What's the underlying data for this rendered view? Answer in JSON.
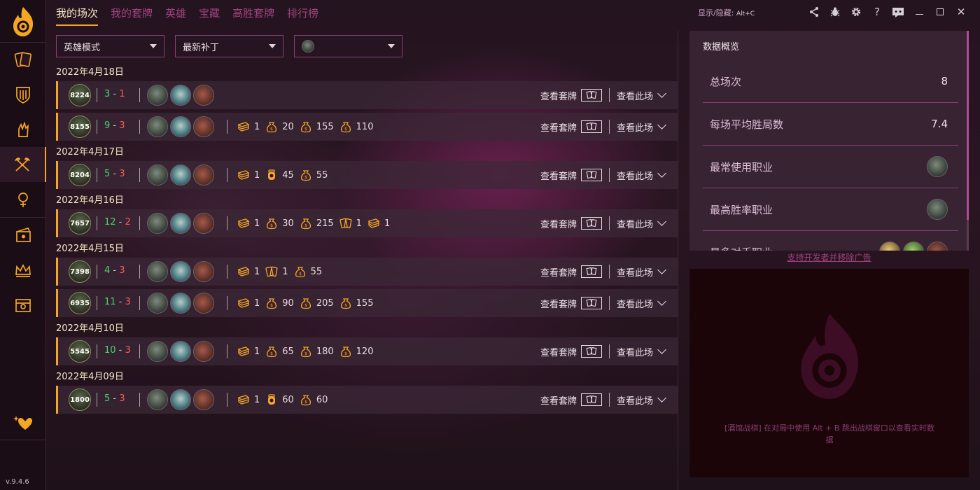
{
  "tabs": [
    {
      "label": "我的场次",
      "active": true
    },
    {
      "label": "我的套牌",
      "active": false
    },
    {
      "label": "英雄",
      "active": false
    },
    {
      "label": "宝藏",
      "active": false
    },
    {
      "label": "高胜套牌",
      "active": false
    },
    {
      "label": "排行榜",
      "active": false
    }
  ],
  "window": {
    "hotkey_label": "显示/隐藏:",
    "hotkey_keys": "Alt+C",
    "icons": [
      "share-icon",
      "bug-icon",
      "settings-icon",
      "help-icon",
      "discord-icon",
      "minimize-icon",
      "maximize-icon",
      "close-icon"
    ]
  },
  "sidebar": {
    "version": "v.9.4.6",
    "items": [
      "cards-icon",
      "deck-shield-icon",
      "arena-hand-icon",
      "duels-crossed-axes-icon",
      "mercenary-icon",
      "tavern-brawl-icon",
      "battlegrounds-crown-icon",
      "treasure-chest-icon"
    ],
    "active_index": 3,
    "bottom_icon": "heart-sparkle-icon"
  },
  "filters": {
    "mode": "英雄模式",
    "patch": "最新补丁",
    "hero": ""
  },
  "labels": {
    "view_deck": "查看套牌",
    "view_match": "查看此场"
  },
  "groups": [
    {
      "date": "2022年4月18日",
      "runs": [
        {
          "rating": "8224",
          "wins": "3",
          "losses": "1",
          "stats": []
        },
        {
          "rating": "8155",
          "wins": "9",
          "losses": "3",
          "stats": [
            {
              "icon": "card-pack-icon",
              "value": "1"
            },
            {
              "icon": "gold-bag-icon",
              "value": "20"
            },
            {
              "icon": "gold-bag-icon",
              "value": "155"
            },
            {
              "icon": "gold-bag-icon",
              "value": "110"
            }
          ]
        }
      ]
    },
    {
      "date": "2022年4月17日",
      "runs": [
        {
          "rating": "8204",
          "wins": "5",
          "losses": "3",
          "stats": [
            {
              "icon": "card-pack-icon",
              "value": "1"
            },
            {
              "icon": "gold-jar-icon",
              "value": "45"
            },
            {
              "icon": "gold-bag-icon",
              "value": "55"
            }
          ]
        }
      ]
    },
    {
      "date": "2022年4月16日",
      "runs": [
        {
          "rating": "7657",
          "wins": "12",
          "losses": "2",
          "stats": [
            {
              "icon": "card-pack-icon",
              "value": "1"
            },
            {
              "icon": "gold-bag-icon",
              "value": "30"
            },
            {
              "icon": "gold-bag-icon",
              "value": "215"
            },
            {
              "icon": "cards-icon",
              "value": "1"
            },
            {
              "icon": "card-pack-icon",
              "value": "1"
            }
          ]
        }
      ]
    },
    {
      "date": "2022年4月15日",
      "runs": [
        {
          "rating": "7398",
          "wins": "4",
          "losses": "3",
          "stats": [
            {
              "icon": "card-pack-icon",
              "value": "1"
            },
            {
              "icon": "cards-icon",
              "value": "1"
            },
            {
              "icon": "gold-bag-icon",
              "value": "55"
            }
          ]
        },
        {
          "rating": "6935",
          "wins": "11",
          "losses": "3",
          "stats": [
            {
              "icon": "card-pack-icon",
              "value": "1"
            },
            {
              "icon": "gold-bag-icon",
              "value": "90"
            },
            {
              "icon": "gold-bag-icon",
              "value": "205"
            },
            {
              "icon": "gold-bag-icon",
              "value": "155"
            }
          ]
        }
      ]
    },
    {
      "date": "2022年4月10日",
      "runs": [
        {
          "rating": "5545",
          "wins": "10",
          "losses": "3",
          "stats": [
            {
              "icon": "card-pack-icon",
              "value": "1"
            },
            {
              "icon": "gold-bag-icon",
              "value": "65"
            },
            {
              "icon": "gold-bag-icon",
              "value": "180"
            },
            {
              "icon": "gold-bag-icon",
              "value": "120"
            }
          ]
        }
      ]
    },
    {
      "date": "2022年4月09日",
      "runs": [
        {
          "rating": "1800",
          "wins": "5",
          "losses": "3",
          "stats": [
            {
              "icon": "card-pack-icon",
              "value": "1"
            },
            {
              "icon": "gold-jar-icon",
              "value": "60"
            },
            {
              "icon": "gold-bag-icon",
              "value": "60"
            }
          ]
        }
      ]
    }
  ],
  "overview": {
    "title": "数据概览",
    "items": [
      {
        "label": "总场次",
        "value": "8"
      },
      {
        "label": "每场平均胜局数",
        "value": "7.4"
      },
      {
        "label": "最常使用职业",
        "value": ""
      },
      {
        "label": "最高胜率职业",
        "value": ""
      },
      {
        "label": "最多对手职业",
        "value": ""
      }
    ]
  },
  "support_link": "支持开发者并移除广告",
  "ad_text": "[酒馆战棋] 在对局中使用 Alt + B 跳出战棋窗口以查看实时数据",
  "colors": {
    "accent": "#f5a623",
    "tab_inactive": "#a0437f",
    "win": "#46d66b",
    "loss": "#ff5a5a",
    "border": "#8a3d74"
  }
}
